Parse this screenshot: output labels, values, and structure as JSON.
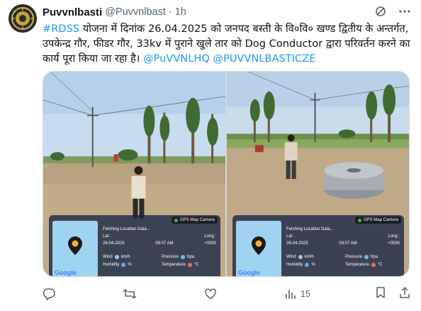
{
  "author": {
    "display_name": "Puvvnlbasti",
    "handle": "@Puvvnlbast",
    "separator": "·",
    "time": "1h",
    "avatar_icon": "org-emblem-icon"
  },
  "tweet": {
    "hashtag": "#RDSS",
    "body": " योजना में दिनांक  26.04.2025 को जनपद बस्ती के वि०वि० खण्ड द्वितीय के अन्तर्गत, उपकेन्द्र गौर, फीडर गौर, 33kv में पुराने खुले तार को Dog Conductor द्वारा परिवर्तन करने का  कार्य पूरा किया जा रहा है। ",
    "mention_1": "@PuVVNLHQ",
    "mention_2": "@PUVVNLBASTICZE"
  },
  "photos": [
    {
      "gps_title": "GPS Map Camera",
      "fetching": "Fetching Location Data...",
      "lat_label": "Lat :",
      "long_label": "Long :",
      "date": "26-04-2025",
      "time": "09:07 AM",
      "tz": "+0530",
      "wind_label": "Wind",
      "wind_unit": "km/h",
      "pressure_label": "Pressure",
      "pressure_unit": "hpa",
      "humidity_label": "Humidity",
      "humidity_unit": "%",
      "temperature_label": "Temperature",
      "temperature_unit": "°C",
      "map_brand": "Google"
    },
    {
      "gps_title": "GPS Map Camera",
      "fetching": "Fetching Location Data...",
      "lat_label": "Lat :",
      "long_label": "Long :",
      "date": "26-04-2025",
      "time": "09:07 AM",
      "tz": "+0530",
      "wind_label": "Wind",
      "wind_unit": "km/h",
      "pressure_label": "Pressure",
      "pressure_unit": "hpa",
      "humidity_label": "Humidity",
      "humidity_unit": "%",
      "temperature_label": "Temperature",
      "temperature_unit": "°C",
      "map_brand": "Google"
    }
  ],
  "actions": {
    "reply_count": "",
    "repost_count": "",
    "like_count": "",
    "views_count": "15"
  },
  "colors": {
    "accent": "#1d9bf0",
    "muted": "#536471",
    "text": "#0f1419"
  }
}
